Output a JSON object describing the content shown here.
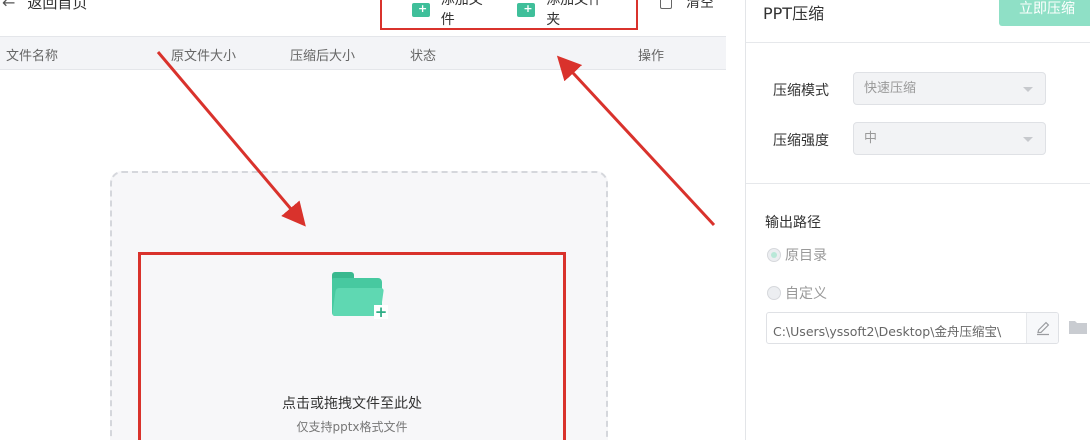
{
  "header": {
    "back_label": "返回首页",
    "add_file_label": "添加文件",
    "add_folder_label": "添加文件夹",
    "clear_label": "清空"
  },
  "table": {
    "columns": [
      "文件名称",
      "原文件大小",
      "压缩后大小",
      "状态",
      "操作"
    ]
  },
  "dropzone": {
    "title": "点击或拖拽文件至此处",
    "subtitle": "仅支持pptx格式文件"
  },
  "panel": {
    "title": "PPT压缩",
    "compress_button": "立即压缩",
    "mode_label": "压缩模式",
    "mode_value": "快速压缩",
    "strength_label": "压缩强度",
    "strength_value": "中",
    "output_label": "输出路径",
    "option_original": "原目录",
    "option_custom": "自定义",
    "path_value": "C:\\Users\\yssoft2\\Desktop\\金舟压缩宝\\"
  },
  "colors": {
    "accent": "#47c9a0",
    "annotation": "#d9322c"
  }
}
